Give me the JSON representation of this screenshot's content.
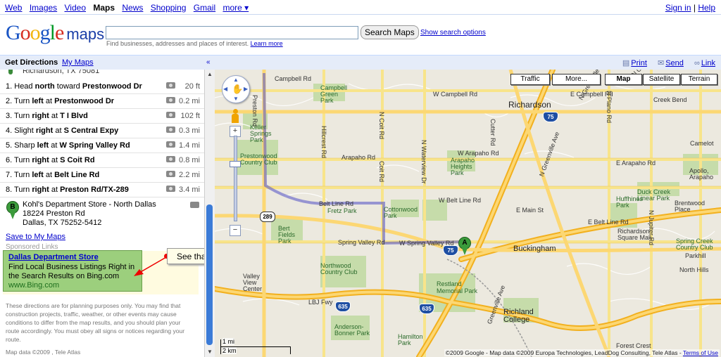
{
  "topnav": {
    "links": [
      "Web",
      "Images",
      "Video",
      "Maps",
      "News",
      "Shopping",
      "Gmail",
      "more ▾"
    ],
    "selected": "Maps",
    "sign_in": "Sign in",
    "separator": " | ",
    "help": "Help"
  },
  "search": {
    "logo_google": "Google",
    "logo_maps": "maps",
    "input_value": "",
    "button": "Search Maps",
    "options": "Show search options",
    "hint": "Find businesses, addresses and places of interest.",
    "learn_more": "Learn more"
  },
  "dirbar": {
    "get_directions": "Get Directions",
    "my_maps": "My Maps",
    "collapse": "«",
    "print": "Print",
    "send": "Send",
    "link": "Link"
  },
  "directions": {
    "start_partial": "Richardson, TX 75081",
    "steps": [
      {
        "num": "1.",
        "pre": "Head ",
        "b1": "north",
        "mid": " toward ",
        "b2": "Prestonwood Dr",
        "dist": "20 ft"
      },
      {
        "num": "2.",
        "pre": "Turn ",
        "b1": "left",
        "mid": " at ",
        "b2": "Prestonwood Dr",
        "dist": "0.2 mi"
      },
      {
        "num": "3.",
        "pre": "Turn ",
        "b1": "right",
        "mid": " at ",
        "b2": "T I Blvd",
        "dist": "102 ft"
      },
      {
        "num": "4.",
        "pre": "Slight ",
        "b1": "right",
        "mid": " at ",
        "b2": "S Central Expy",
        "dist": "0.3 mi"
      },
      {
        "num": "5.",
        "pre": "Sharp ",
        "b1": "left",
        "mid": " at ",
        "b2": "W Spring Valley Rd",
        "dist": "1.4 mi"
      },
      {
        "num": "6.",
        "pre": "Turn ",
        "b1": "right",
        "mid": " at ",
        "b2": "S Coit Rd",
        "dist": "0.8 mi"
      },
      {
        "num": "7.",
        "pre": "Turn ",
        "b1": "left",
        "mid": " at ",
        "b2": "Belt Line Rd",
        "dist": "2.2 mi"
      },
      {
        "num": "8.",
        "pre": "Turn ",
        "b1": "right",
        "mid": " at ",
        "b2": "Preston Rd/TX-289",
        "dist": "3.4 mi"
      }
    ],
    "dest_marker": "B",
    "dest_name": "Kohl's Department Store - North Dallas",
    "dest_street": "18224 Preston Rd",
    "dest_city": "Dallas, TX 75252-5412",
    "save": "Save to My Maps",
    "sponsored": "Sponsored Links"
  },
  "ad": {
    "title": "Dallas Department Store",
    "desc": "Find Local Business Listings Right in the Search Results on Bing.com",
    "url": "www.Bing.com"
  },
  "callout": "See that !!!!!!",
  "disclaimer": "These directions are for planning purposes only. You may find that construction projects, traffic, weather, or other events may cause conditions to differ from the map results, and you should plan your route accordingly. You must obey all signs or notices regarding your route.",
  "map_data_left": "Map data ©2009 , Tele Atlas",
  "map": {
    "buttons": {
      "traffic": "Traffic",
      "more": "More...",
      "map": "Map",
      "satellite": "Satellite",
      "terrain": "Terrain"
    },
    "selected_type": "Map",
    "marker_a": "A",
    "scale_1": "1 mi",
    "scale_2": "2 km",
    "copyright": "©2009 Google - Map data ©2009 Europa Technologies, LeadDog Consulting, Tele Atlas - ",
    "terms": "Terms of Use",
    "labels": {
      "richardson": "Richardson",
      "buckingham": "Buckingham",
      "campbell_rd": "Campbell Rd",
      "campbell_green": "Campbell Green Park",
      "w_campbell": "W Campbell Rd",
      "e_campbell": "E Campbell Rd",
      "keller": "Keller Springs Park",
      "prestonwood": "Prestonwood Country Club",
      "arapaho_w": "W Arapaho Rd",
      "arapaho": "Arapaho Rd",
      "arapaho_e": "E Arapaho Rd",
      "arapaho_heights": "Arapaho Heights Park",
      "belt_line": "Belt Line Rd",
      "w_belt_line": "W Belt Line Rd",
      "e_belt_line": "E Belt Line Rd",
      "fretz": "Fretz Park",
      "cottonwood": "Cottonwood Park",
      "bert_fields": "Bert Fields Park",
      "spring_valley": "Spring Valley Rd",
      "w_spring_valley": "W Spring Valley Rd",
      "e_main": "E Main St",
      "restland": "Restland Memorial Park",
      "northwood": "Northwood Country Club",
      "valley_view": "Valley View Center",
      "lbj": "LBJ Fwy",
      "anderson": "Anderson-Bonner Park",
      "hamilton": "Hamilton Park",
      "richland": "Richland College",
      "forest_crest": "Forest Crest",
      "creek_bend": "Creek Bend",
      "camelot": "Camelot",
      "apollo": "Apollo, Arapaho",
      "duck_creek": "Duck Creek Linear Park",
      "huffhines": "Huffhines Park",
      "brentwood": "Brentwood Place",
      "richardson_square": "Richardson Square Mall",
      "spring_creek": "Spring Creek Country Club",
      "parkhill": "Parkhill",
      "north_hills": "North Hills",
      "preston_rd": "Preston Rd",
      "hillcrest": "Hillcrest Rd",
      "coit": "N Coit Rd",
      "coit2": "Coit Rd",
      "waterview": "N Waterview Dr",
      "cutter": "Cutter Rd",
      "greenville": "N Greenville Ave",
      "greenville2": "Greenville Ave",
      "plano": "N Plano Rd",
      "jupiter": "N Jupiter Rd",
      "collins": "N Collins Blvd",
      "n_greenville": "N Greenville",
      "i75": "75",
      "i635": "635",
      "tx289": "289"
    }
  }
}
